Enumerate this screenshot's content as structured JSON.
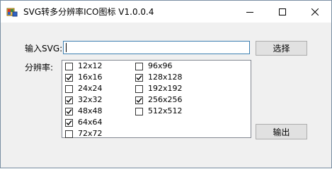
{
  "window": {
    "title": "SVG转多分辨率ICO图标 V1.0.0.4",
    "app_icon": "app-icon",
    "controls": {
      "minimize_icon": "minimize-icon",
      "maximize_icon": "maximize-icon",
      "close_icon": "close-icon"
    }
  },
  "form": {
    "svg_label": "输入SVG:",
    "svg_value": "",
    "select_button": "选择",
    "resolution_label": "分辨率:",
    "output_button": "输出"
  },
  "resolutions": {
    "column1": [
      {
        "label": "12x12",
        "checked": false
      },
      {
        "label": "16x16",
        "checked": true
      },
      {
        "label": "24x24",
        "checked": false
      },
      {
        "label": "32x32",
        "checked": true
      },
      {
        "label": "48x48",
        "checked": true
      },
      {
        "label": "64x64",
        "checked": true
      },
      {
        "label": "72x72",
        "checked": false
      }
    ],
    "column2": [
      {
        "label": "96x96",
        "checked": false
      },
      {
        "label": "128x128",
        "checked": true
      },
      {
        "label": "192x192",
        "checked": false
      },
      {
        "label": "256x256",
        "checked": true
      },
      {
        "label": "512x512",
        "checked": false
      }
    ]
  }
}
